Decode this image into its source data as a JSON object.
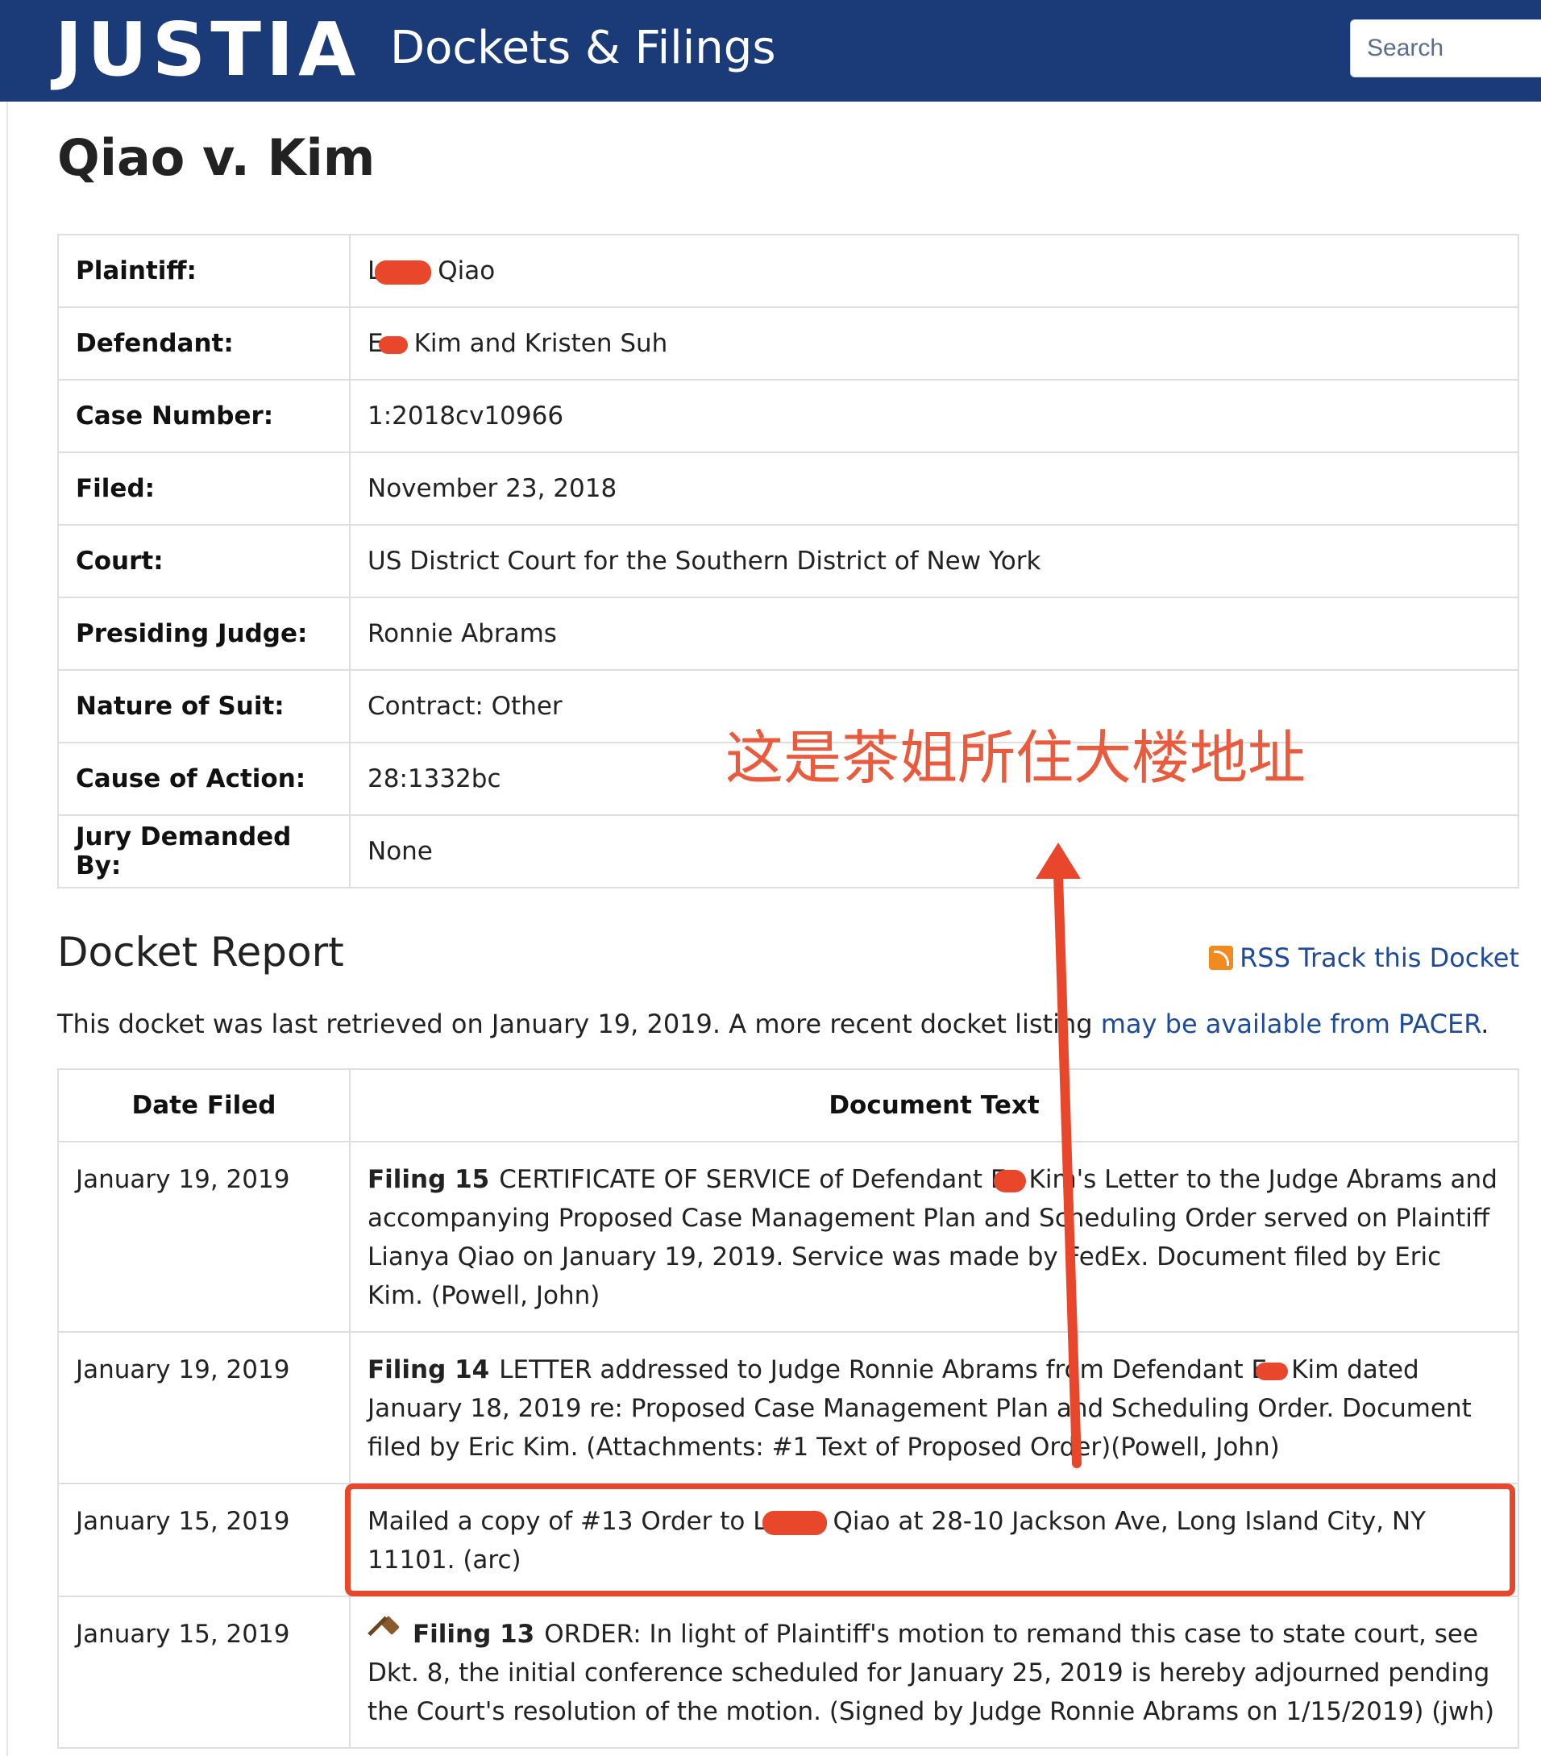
{
  "header": {
    "logo": "JUSTIA",
    "section": "Dockets & Filings",
    "search_placeholder": "Search"
  },
  "case": {
    "title": "Qiao v. Kim",
    "fields": [
      {
        "label": "Plaintiff:",
        "value_pre": "L",
        "value_post": "Qiao"
      },
      {
        "label": "Defendant:",
        "value_pre": "E",
        "value_post": "Kim and Kristen Suh"
      },
      {
        "label": "Case Number:",
        "value": "1:2018cv10966"
      },
      {
        "label": "Filed:",
        "value": "November 23, 2018"
      },
      {
        "label": "Court:",
        "value": "US District Court for the Southern District of New York"
      },
      {
        "label": "Presiding Judge:",
        "value": "Ronnie Abrams"
      },
      {
        "label": "Nature of Suit:",
        "value": "Contract: Other"
      },
      {
        "label": "Cause of Action:",
        "value": "28:1332bc"
      },
      {
        "label": "Jury Demanded By:",
        "value": "None"
      }
    ]
  },
  "annotation": {
    "text": "这是茶姐所住大楼地址",
    "color": "#ea5a3c"
  },
  "docket": {
    "heading": "Docket Report",
    "rss_label": "RSS Track this Docket",
    "retrieved_text": "This docket was last retrieved on January 19, 2019. A more recent docket listing",
    "retrieved_link": "may be available from PACER",
    "retrieved_end": ".",
    "columns": [
      "Date Filed",
      "Document Text"
    ],
    "entries": [
      {
        "date": "January 19, 2019",
        "filing": "Filing 15",
        "text_pre": "CERTIFICATE OF SERVICE of Defendant E",
        "text_post": "Kim's Letter to the Judge Abrams and accompanying Proposed Case Management Plan and Scheduling Order served on Plaintiff Lianya Qiao on January 19, 2019. Service was made by FedEx. Document filed by Eric Kim. (Powell, John)"
      },
      {
        "date": "January 19, 2019",
        "filing": "Filing 14",
        "text_pre": "LETTER addressed to Judge Ronnie Abrams from Defendant E",
        "text_post": "Kim dated January 18, 2019 re: Proposed Case Management Plan and Scheduling Order. Document filed by Eric Kim. (Attachments: #1 Text of Proposed Order)(Powell, John)"
      },
      {
        "date": "January 15, 2019",
        "filing": "",
        "text_pre": "Mailed a copy of #13 Order to L",
        "text_post": "Qiao at 28-10 Jackson Ave, Long Island City, NY 11101. (arc)"
      },
      {
        "date": "January 15, 2019",
        "filing": "Filing 13",
        "text_pre": "ORDER: In light of Plaintiff's motion to remand this case to state court, see Dkt. 8, the initial conference scheduled for January 25, 2019 is hereby adjourned pending the Court's resolution of the motion. (Signed by Judge Ronnie Abrams on 1/15/2019) (jwh)",
        "text_post": ""
      }
    ]
  }
}
